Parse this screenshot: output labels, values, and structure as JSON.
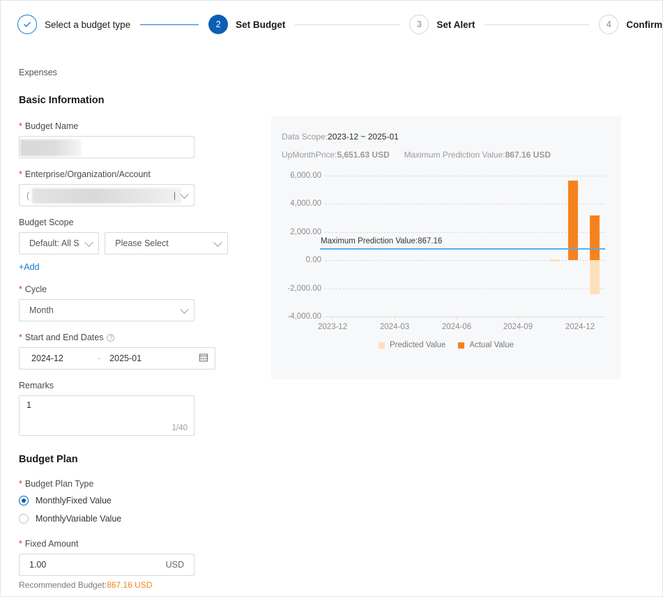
{
  "stepper": {
    "steps": [
      {
        "marker": "check",
        "label": "Select a budget type",
        "state": "done"
      },
      {
        "marker": "2",
        "label": "Set Budget",
        "state": "active"
      },
      {
        "marker": "3",
        "label": "Set Alert",
        "state": "todo"
      },
      {
        "marker": "4",
        "label": "Confirm",
        "state": "todo"
      }
    ]
  },
  "form": {
    "breadcrumb": "Expenses",
    "basic_section_title": "Basic Information",
    "budget_name_label": "Budget Name",
    "budget_name_value": "",
    "enterprise_label": "Enterprise/Organization/Account",
    "enterprise_value": "",
    "budget_scope_label": "Budget Scope",
    "scope_dim_value": "Default: All S",
    "scope_val_placeholder": "Please Select",
    "add_link": "+Add",
    "cycle_label": "Cycle",
    "cycle_value": "Month",
    "dates_label": "Start and End Dates",
    "date_start": "2024-12",
    "date_end": "2025-01",
    "date_separator": "-",
    "remarks_label": "Remarks",
    "remarks_value": "1",
    "remarks_counter": "1/40",
    "plan_section_title": "Budget Plan",
    "plan_type_label": "Budget Plan Type",
    "plan_type_options": [
      {
        "label": "MonthlyFixed Value",
        "selected": true
      },
      {
        "label": "MonthlyVariable Value",
        "selected": false
      }
    ],
    "fixed_amount_label": "Fixed Amount",
    "fixed_amount_value": "1.00",
    "fixed_amount_unit": "USD",
    "recommended_prefix": "Recommended Budget:",
    "recommended_value": "867.16 USD"
  },
  "chart_panel": {
    "data_scope_label": "Data Scope:",
    "data_scope_value": "2023-12 ~ 2025-01",
    "up_month_label": "UpMonthPrice:",
    "up_month_value": "5,651.63 USD",
    "max_pred_label": "Maximum Prediction Value:",
    "max_pred_value": "867.16 USD"
  },
  "chart_data": {
    "type": "bar",
    "title": "",
    "xlabel": "",
    "ylabel": "",
    "ylim": [
      -4000,
      6000
    ],
    "yticks": [
      "6,000.00",
      "4,000.00",
      "2,000.00",
      "0.00",
      "-2,000.00",
      "-4,000.00"
    ],
    "ytick_values": [
      6000,
      4000,
      2000,
      0,
      -2000,
      -4000
    ],
    "xticks": [
      "2023-12",
      "2024-03",
      "2024-06",
      "2024-09",
      "2024-12"
    ],
    "grid": true,
    "legend_position": "bottom",
    "series": [
      {
        "name": "Predicted Value",
        "color": "#fde0bb",
        "points": [
          {
            "x": "2024-11",
            "y": -60
          },
          {
            "x": "2025-01",
            "y": -2400
          }
        ]
      },
      {
        "name": "Actual Value",
        "color": "#f5821f",
        "points": [
          {
            "x": "2024-12",
            "y": 5651.63
          },
          {
            "x": "2025-01",
            "y": 3200
          }
        ]
      }
    ],
    "annotations": [
      {
        "type": "hline",
        "label": "Maximum Prediction Value:867.16",
        "value": 867.16,
        "color": "#53b0ef"
      }
    ]
  }
}
